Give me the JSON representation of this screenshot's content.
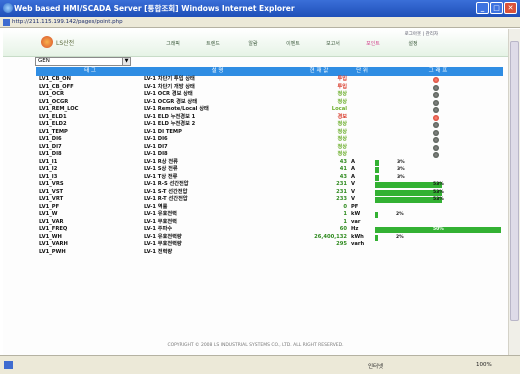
{
  "window": {
    "title": "Web based HMI/SCADA Server  [통합조회]   Windows Internet Explorer"
  },
  "address": {
    "url": "http://211.115.199.142/pages/point.php"
  },
  "header": {
    "logo_text": "LS산전",
    "nav": [
      "그래픽",
      "트렌드",
      "알람",
      "이벤트",
      "보고서",
      "포인트",
      "설정"
    ],
    "active_nav": "포인트",
    "top_links": "로그아웃 | 관리자"
  },
  "group_select": {
    "value": "GEN"
  },
  "table": {
    "headers": [
      "태 그",
      "설 명",
      "현 재 값",
      "단 위",
      "그 래 프"
    ],
    "rows": [
      {
        "tag": "LV1_CB_ON",
        "desc": "LV-1 차단기 투입 상태",
        "value": "투입",
        "unit": "",
        "graph": "dot-red"
      },
      {
        "tag": "LV1_CB_OFF",
        "desc": "LV-1 차단기 개방 상태",
        "value": "투입",
        "unit": "",
        "graph": "dot"
      },
      {
        "tag": "LV1_OCR",
        "desc": "LV-1 OCR 경보 상태",
        "value": "정상",
        "unit": "",
        "graph": "dot"
      },
      {
        "tag": "LV1_OCGR",
        "desc": "LV-1 OCGR 경보 상태",
        "value": "정상",
        "unit": "",
        "graph": "dot"
      },
      {
        "tag": "LV1_REM_LOC",
        "desc": "LV-1 Remote/Local 상태",
        "value": "Local",
        "unit": "",
        "graph": "dot"
      },
      {
        "tag": "LV1_ELD1",
        "desc": "LV-1 ELD 누전경보 1",
        "value": "경보",
        "unit": "",
        "graph": "dot-red"
      },
      {
        "tag": "LV1_ELD2",
        "desc": "LV-1 ELD 누전경보 2",
        "value": "정상",
        "unit": "",
        "graph": "dot"
      },
      {
        "tag": "LV1_TEMP",
        "desc": "LV-1 DI TEMP",
        "value": "정상",
        "unit": "",
        "graph": "dot"
      },
      {
        "tag": "LV1_DI6",
        "desc": "LV-1 DI6",
        "value": "정상",
        "unit": "",
        "graph": "dot"
      },
      {
        "tag": "LV1_DI7",
        "desc": "LV-1 DI7",
        "value": "정상",
        "unit": "",
        "graph": "dot"
      },
      {
        "tag": "LV1_DI8",
        "desc": "LV-1 DI8",
        "value": "정상",
        "unit": "",
        "graph": "dot"
      },
      {
        "tag": "LV1_I1",
        "desc": "LV-1 R상 전류",
        "value": "43",
        "unit": "A",
        "graph": "bar",
        "pct": 3,
        "pct_label": "3%"
      },
      {
        "tag": "LV1_I2",
        "desc": "LV-1 S상 전류",
        "value": "41",
        "unit": "A",
        "graph": "bar",
        "pct": 3,
        "pct_label": "3%"
      },
      {
        "tag": "LV1_I3",
        "desc": "LV-1 T상 전류",
        "value": "43",
        "unit": "A",
        "graph": "bar",
        "pct": 3,
        "pct_label": "3%"
      },
      {
        "tag": "LV1_VRS",
        "desc": "LV-1 R-S 선간전압",
        "value": "231",
        "unit": "V",
        "graph": "bar",
        "pct": 53,
        "pct_label": "53%"
      },
      {
        "tag": "LV1_VST",
        "desc": "LV-1 S-T 선간전압",
        "value": "231",
        "unit": "V",
        "graph": "bar",
        "pct": 53,
        "pct_label": "53%"
      },
      {
        "tag": "LV1_VRT",
        "desc": "LV-1 R-T 선간전압",
        "value": "233",
        "unit": "V",
        "graph": "bar",
        "pct": 53,
        "pct_label": "53%"
      },
      {
        "tag": "LV1_PF",
        "desc": "LV-1 역률",
        "value": "0",
        "unit": "PF",
        "graph": "none"
      },
      {
        "tag": "LV1_W",
        "desc": "LV-1 유효전력",
        "value": "1",
        "unit": "kW",
        "graph": "bar",
        "pct": 2,
        "pct_label": "2%"
      },
      {
        "tag": "LV1_VAR",
        "desc": "LV-1 무효전력",
        "value": "1",
        "unit": "var",
        "graph": "none"
      },
      {
        "tag": "LV1_FREQ",
        "desc": "LV-1 주파수",
        "value": "60",
        "unit": "Hz",
        "graph": "bar",
        "pct": 100,
        "pct_label": "50%"
      },
      {
        "tag": "LV1_WH",
        "desc": "LV-1 유효전력량",
        "value": "26,400,132",
        "unit": "kWh",
        "graph": "bar",
        "pct": 2,
        "pct_label": "2%"
      },
      {
        "tag": "LV1_VARH",
        "desc": "LV-1 무효전력량",
        "value": "295",
        "unit": "varh",
        "graph": "none"
      },
      {
        "tag": "LV1_PWH",
        "desc": "LV-1 전력량",
        "value": "",
        "unit": "",
        "graph": "none"
      }
    ]
  },
  "footer": {
    "text": "COPYRIGHT © 2008 LS INDUSTRIAL SYSTEMS CO., LTD. ALL RIGHT RESERVED."
  },
  "status": {
    "zone": "인터넷",
    "zoom": "100%"
  }
}
